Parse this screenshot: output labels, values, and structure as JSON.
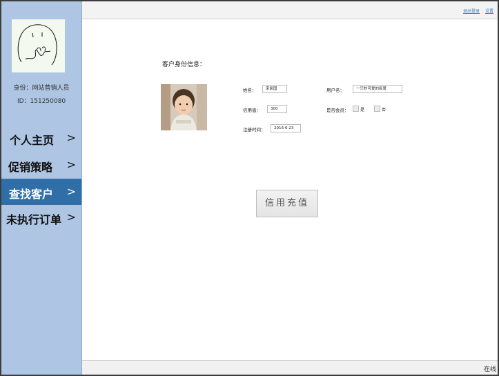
{
  "sidebar": {
    "identity_role": "身份：网站营销人员",
    "identity_id": "ID：151250080",
    "items": [
      {
        "label": "个人主页",
        "arrow": ">"
      },
      {
        "label": "促销策略",
        "arrow": ">"
      },
      {
        "label": "查找客户",
        "arrow": ">"
      },
      {
        "label": "未执行订单",
        "arrow": ">"
      }
    ]
  },
  "topbar": {
    "logout_label": "退出登录",
    "settings_label": "设置"
  },
  "main": {
    "section_title": "客户身份信息：",
    "name_label": "姓名：",
    "name_value": "宋民国",
    "username_label": "用户名：",
    "username_value": "一只秒可爱的民哥",
    "credit_label": "信用值：",
    "credit_value": "300",
    "member_label": "是否会员：",
    "member_yes": "是",
    "member_no": "否",
    "regtime_label": "注册时间：",
    "regtime_value": "2016-6-23",
    "recharge_button": "信用充值"
  },
  "status": {
    "text": "在线"
  },
  "colors": {
    "sidebar_bg": "#aec6e4",
    "active_item": "#2f6ea6",
    "link": "#3a7fc4"
  }
}
